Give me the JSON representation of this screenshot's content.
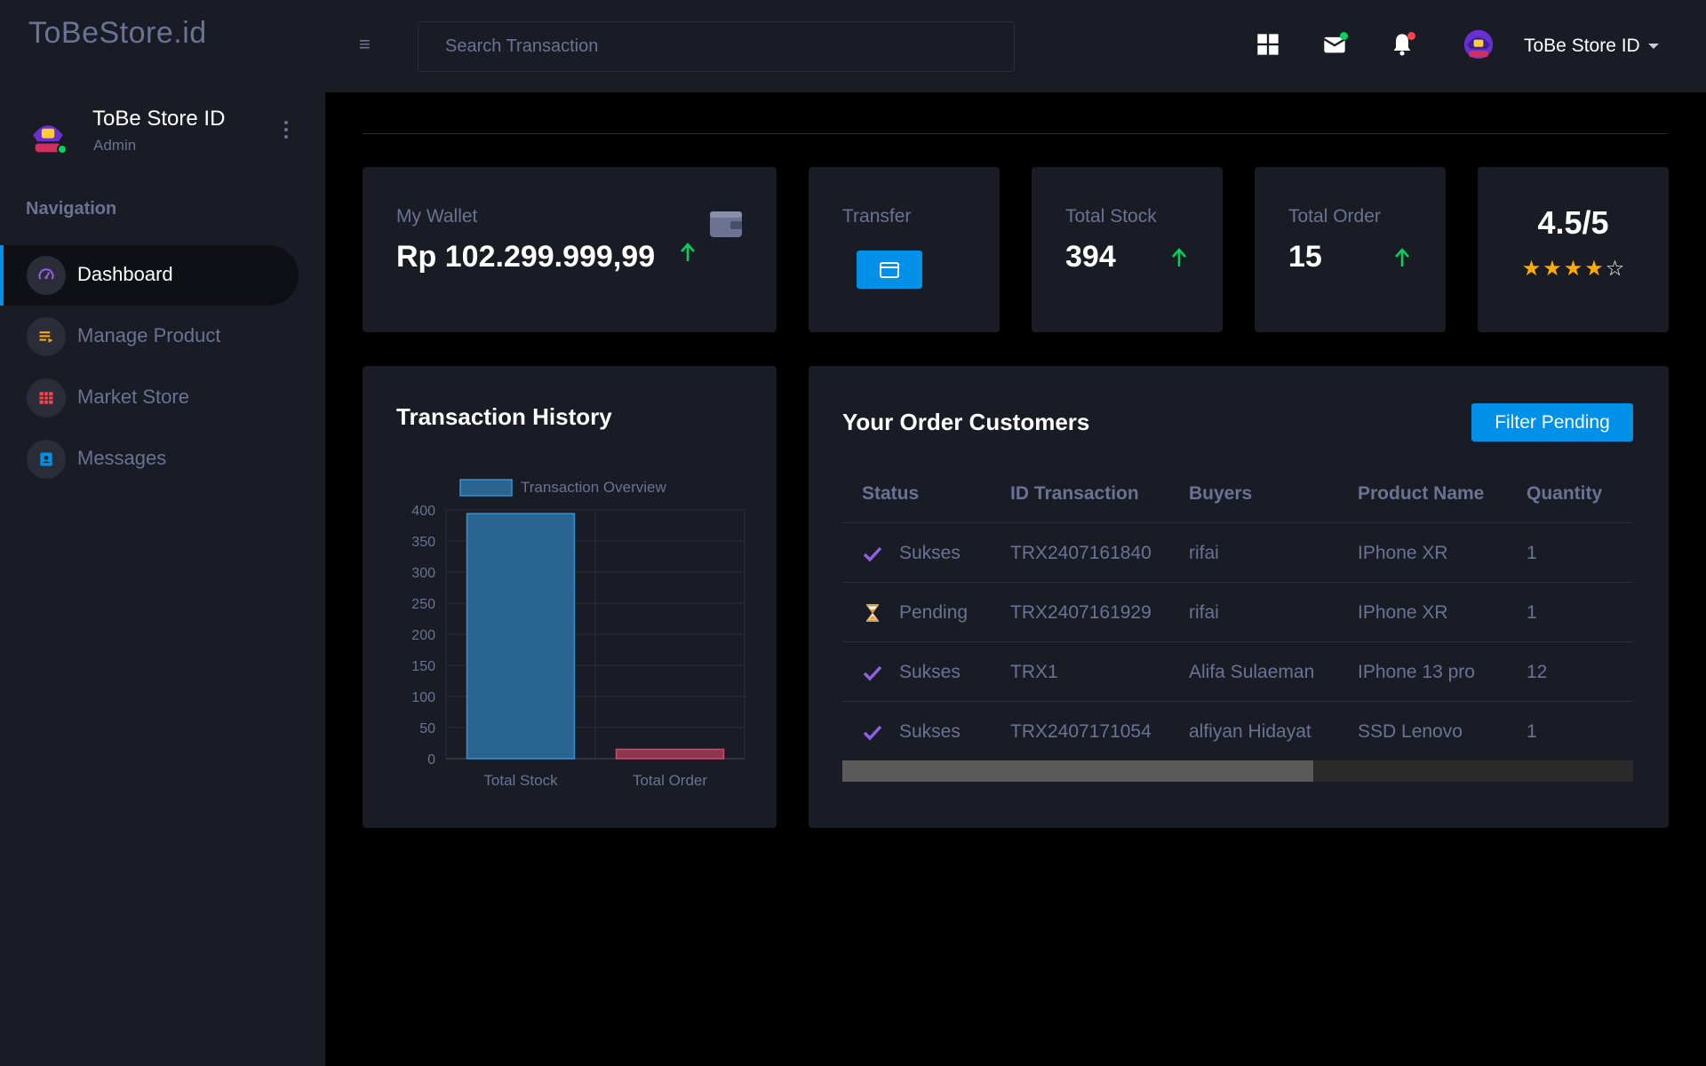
{
  "topbar": {
    "brand": "ToBeStore.id",
    "search_placeholder": "Search Transaction",
    "username": "ToBe Store ID",
    "icons": [
      "grid-icon",
      "mail-icon",
      "bell-icon"
    ],
    "mail_dot_color": "#00d25b",
    "bell_dot_color": "#fc424a"
  },
  "sidebar": {
    "profile_name": "ToBe Store ID",
    "profile_role": "Admin",
    "nav_title": "Navigation",
    "items": [
      {
        "label": "Dashboard",
        "icon": "speedometer-icon",
        "icon_color": "#8f5fe8",
        "active": true
      },
      {
        "label": "Manage Product",
        "icon": "list-icon",
        "icon_color": "#ffab00",
        "active": false
      },
      {
        "label": "Market Store",
        "icon": "table-icon",
        "icon_color": "#fc424a",
        "active": false
      },
      {
        "label": "Messages",
        "icon": "contacts-icon",
        "icon_color": "#0090e7",
        "active": false
      }
    ]
  },
  "stats": {
    "wallet": {
      "label": "My Wallet",
      "value": "Rp 102.299.999,99"
    },
    "transfer": {
      "label": "Transfer"
    },
    "total_stock": {
      "label": "Total Stock",
      "value": "394"
    },
    "total_order": {
      "label": "Total Order",
      "value": "15"
    },
    "rating": {
      "value": "4.5/5",
      "stars_filled": 4,
      "stars_total": 5
    }
  },
  "transaction_history": {
    "title": "Transaction History"
  },
  "chart_data": {
    "type": "bar",
    "categories": [
      "Total Stock",
      "Total Order"
    ],
    "series": [
      {
        "name": "Transaction Overview",
        "values": [
          394,
          15
        ]
      }
    ],
    "bar_colors": [
      "#2a6490",
      "#8e3550"
    ],
    "bar_border_colors": [
      "#3a8fd0",
      "#d04a6a"
    ],
    "ylim": [
      0,
      400
    ],
    "yticks": [
      0,
      50,
      100,
      150,
      200,
      250,
      300,
      350,
      400
    ],
    "grid": true,
    "legend": "top"
  },
  "orders": {
    "title": "Your Order Customers",
    "filter_label": "Filter Pending",
    "columns": [
      "Status",
      "ID Transaction",
      "Buyers",
      "Product Name",
      "Quantity"
    ],
    "rows": [
      {
        "status": "Sukses",
        "status_icon": "check-icon",
        "id": "TRX2407161840",
        "buyer": "rifai",
        "product": "IPhone XR",
        "qty": "1"
      },
      {
        "status": "Pending",
        "status_icon": "hourglass-icon",
        "id": "TRX2407161929",
        "buyer": "rifai",
        "product": "IPhone XR",
        "qty": "1"
      },
      {
        "status": "Sukses",
        "status_icon": "check-icon",
        "id": "TRX1",
        "buyer": "Alifa Sulaeman",
        "product": "IPhone 13 pro",
        "qty": "12"
      },
      {
        "status": "Sukses",
        "status_icon": "check-icon",
        "id": "TRX2407171054",
        "buyer": "alfiyan Hidayat",
        "product": "SSD Lenovo",
        "qty": "1"
      }
    ]
  }
}
